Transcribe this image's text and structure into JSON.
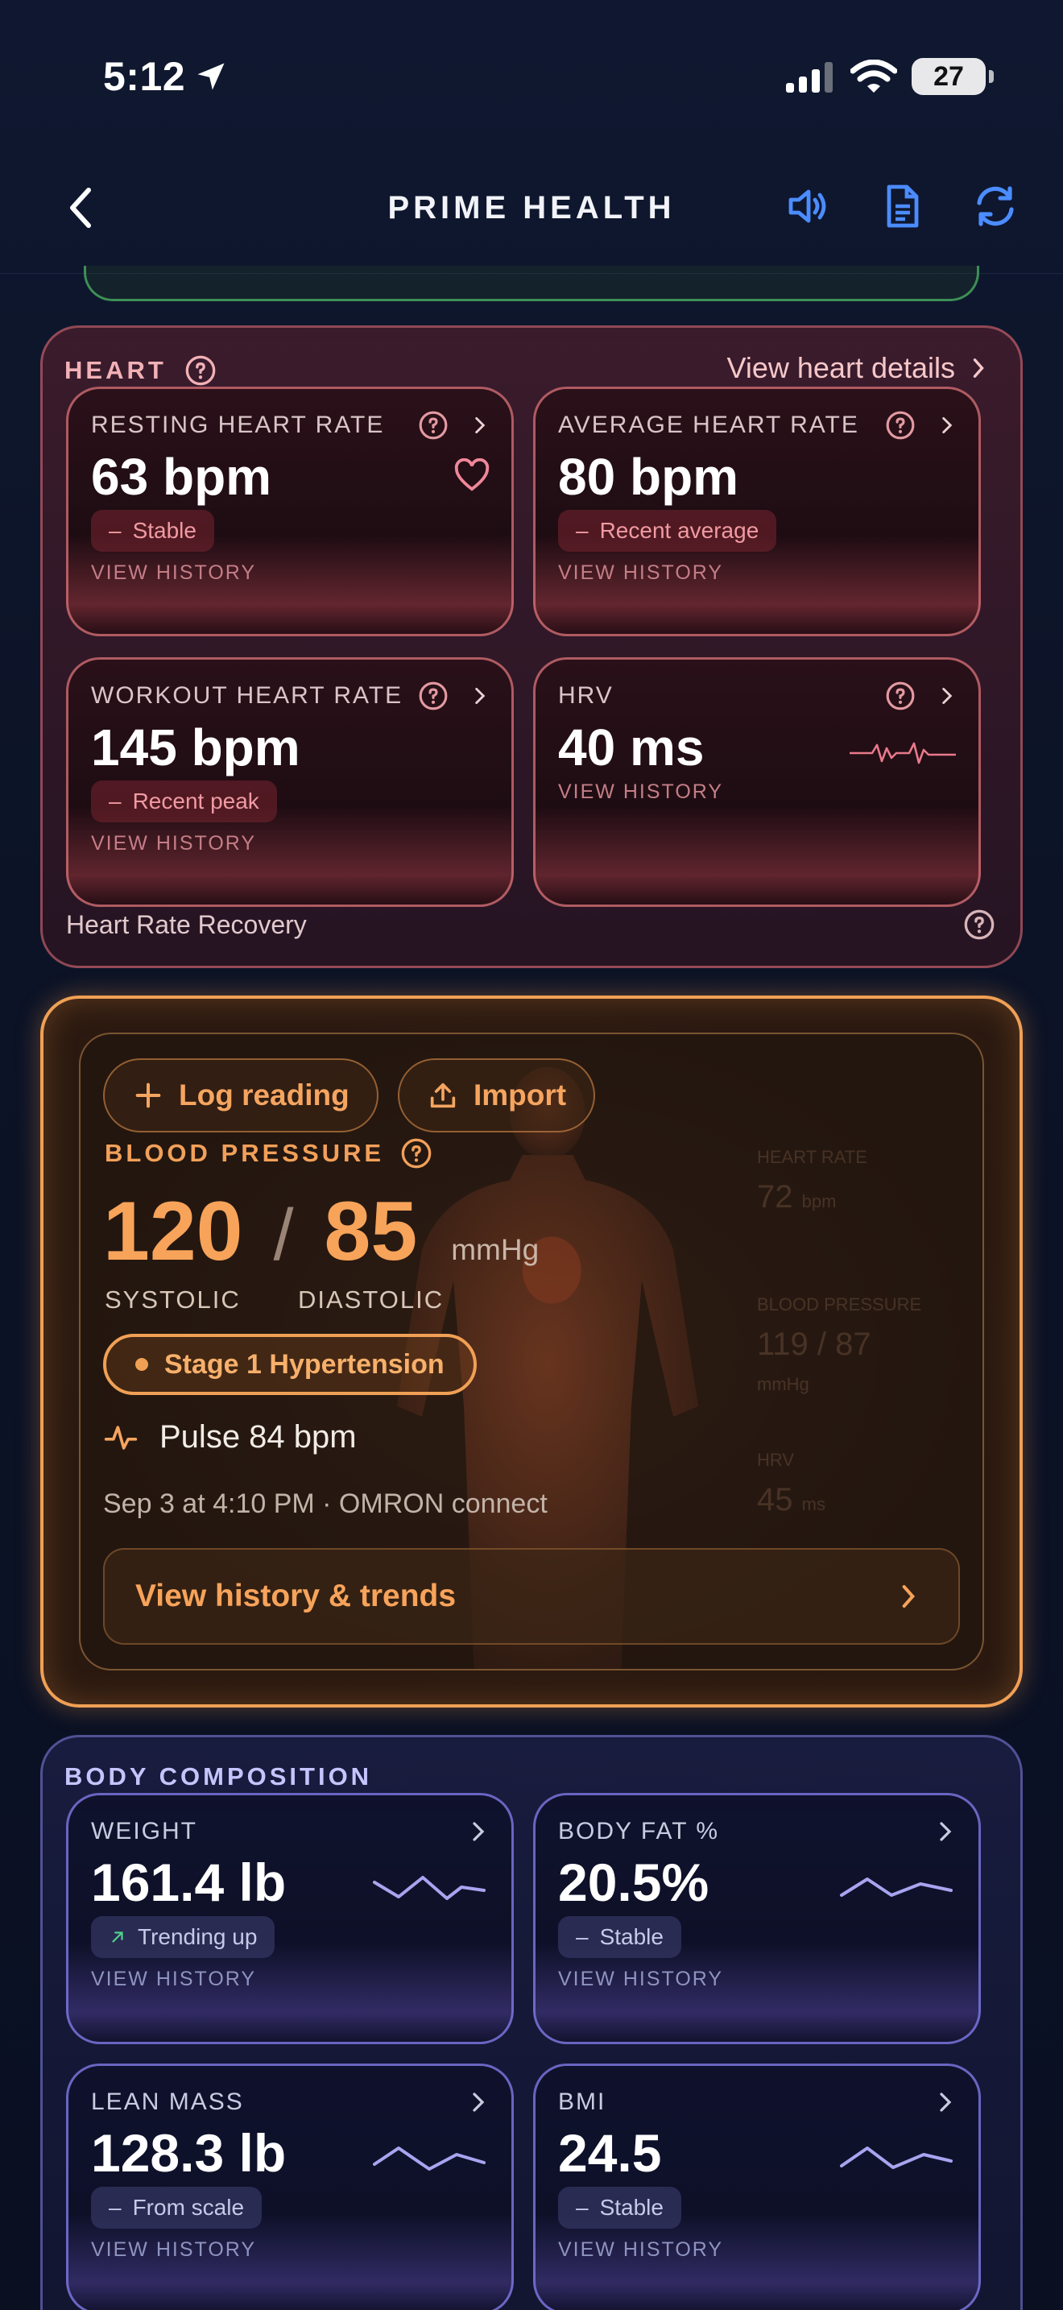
{
  "status_bar": {
    "time": "5:12",
    "battery": "27"
  },
  "header": {
    "title": "PRIME HEALTH"
  },
  "heart": {
    "label": "HEART",
    "view_details": "View heart details",
    "cards": [
      {
        "title": "RESTING HEART RATE",
        "value": "63 bpm",
        "badge": "Stable",
        "history": "VIEW HISTORY"
      },
      {
        "title": "AVERAGE HEART RATE",
        "value": "80 bpm",
        "badge": "Recent average",
        "history": "VIEW HISTORY"
      },
      {
        "title": "WORKOUT HEART RATE",
        "value": "145 bpm",
        "badge": "Recent peak",
        "history": "VIEW HISTORY"
      },
      {
        "title": "HRV",
        "value": "40 ms",
        "history": "VIEW HISTORY"
      }
    ],
    "recovery_label": "Heart Rate Recovery"
  },
  "blood_pressure": {
    "log_label": "Log reading",
    "import_label": "Import",
    "label": "BLOOD PRESSURE",
    "systolic": "120",
    "slash": "/",
    "diastolic": "85",
    "unit": "mmHg",
    "systolic_label": "SYSTOLIC",
    "diastolic_label": "DIASTOLIC",
    "stage": "Stage 1 Hypertension",
    "pulse": "Pulse 84 bpm",
    "date": "Sep 3 at 4:10 PM · OMRON connect",
    "view_trends": "View history & trends",
    "ghost": {
      "hr_label": "HEART RATE",
      "hr_value": "72",
      "hr_unit": "bpm",
      "bp_label": "BLOOD PRESSURE",
      "bp_value": "119 / 87",
      "bp_unit": "mmHg",
      "hrv_label": "HRV",
      "hrv_value": "45",
      "hrv_unit": "ms"
    }
  },
  "body_composition": {
    "label": "BODY COMPOSITION",
    "cards": [
      {
        "title": "WEIGHT",
        "value": "161.4 lb",
        "badge": "Trending up",
        "history": "VIEW HISTORY"
      },
      {
        "title": "BODY FAT %",
        "value": "20.5%",
        "badge": "Stable",
        "history": "VIEW HISTORY"
      },
      {
        "title": "LEAN MASS",
        "value": "128.3 lb",
        "badge": "From scale",
        "history": "VIEW HISTORY"
      },
      {
        "title": "BMI",
        "value": "24.5",
        "badge": "Stable",
        "history": "VIEW HISTORY"
      }
    ]
  },
  "colors": {
    "heart_accent": "#f09aa2",
    "bp_accent": "#f0a055",
    "body_accent": "#7a74dc",
    "header_icon": "#4b8cff"
  },
  "icons": [
    "location-arrow-icon",
    "signal-icon",
    "wifi-icon",
    "back-icon",
    "speaker-icon",
    "document-icon",
    "refresh-icon",
    "help-icon",
    "chevron-right-icon",
    "heart-icon",
    "hrv-wave-icon",
    "plus-icon",
    "upload-icon",
    "pulse-icon",
    "trend-up-icon",
    "dash-icon"
  ]
}
